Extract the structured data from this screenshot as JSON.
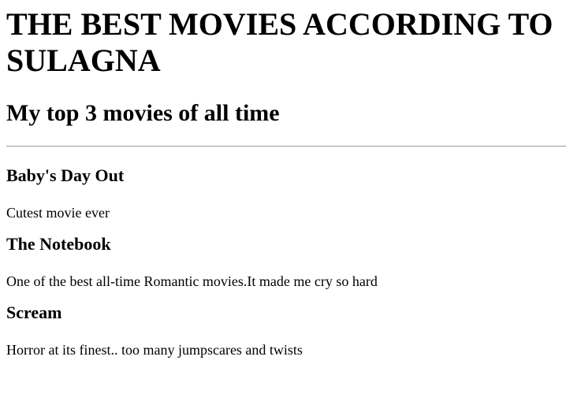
{
  "header": {
    "title": "THE BEST MOVIES ACCORDING TO SULAGNA",
    "subtitle": "My top 3 movies of all time"
  },
  "movies": [
    {
      "name": "Baby's Day Out",
      "description": "Cutest movie ever"
    },
    {
      "name": "The Notebook",
      "description": "One of the best all-time Romantic movies.It made me cry so hard"
    },
    {
      "name": "Scream",
      "description": "Horror at its finest.. too many jumpscares and twists"
    }
  ]
}
